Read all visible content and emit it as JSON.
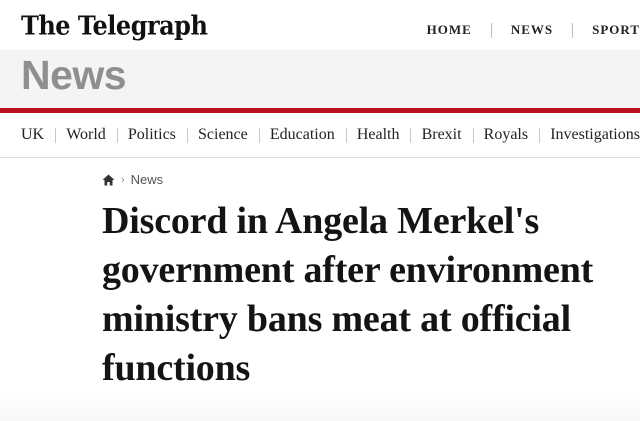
{
  "site": {
    "logo": "The Telegraph",
    "top_nav": [
      "HOME",
      "NEWS",
      "SPORT"
    ]
  },
  "section": {
    "title": "News",
    "accent_color": "#b9101f"
  },
  "subnav": [
    "UK",
    "World",
    "Politics",
    "Science",
    "Education",
    "Health",
    "Brexit",
    "Royals",
    "Investigations"
  ],
  "breadcrumb": {
    "home_icon": "home-icon",
    "current": "News"
  },
  "article": {
    "headline": "Discord in Angela Merkel's government after environment ministry bans meat at official functions"
  }
}
